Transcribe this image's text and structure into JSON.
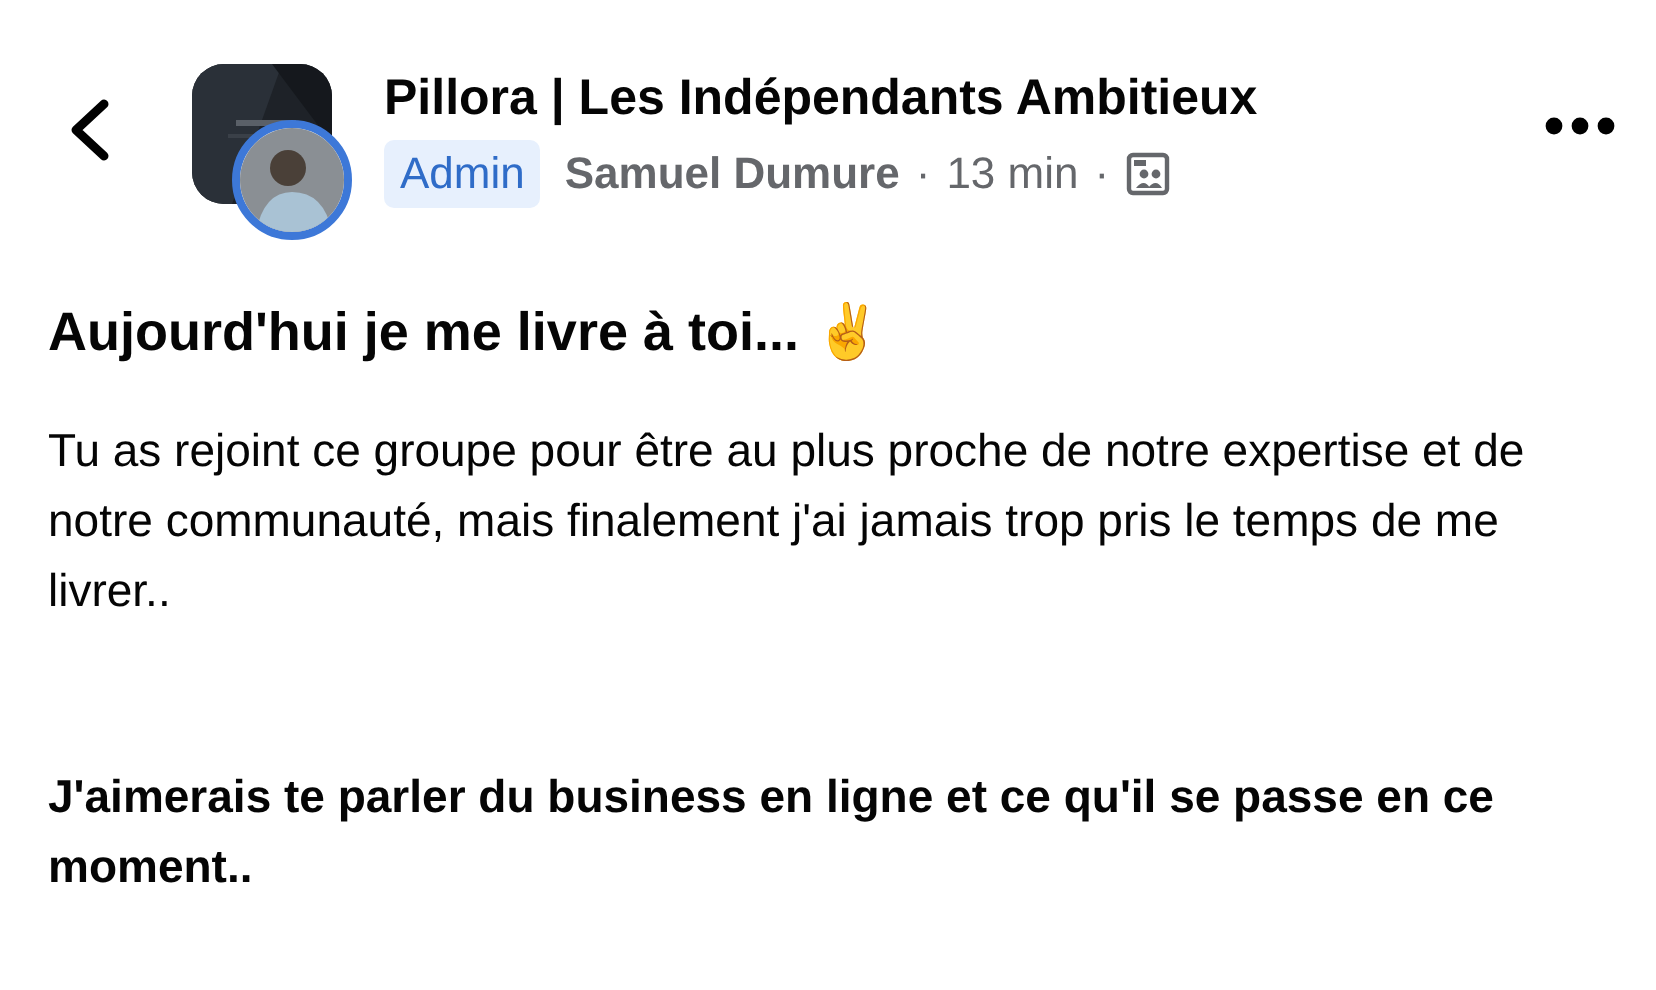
{
  "header": {
    "group_name": "Pillora | Les Indépendants Ambitieux",
    "role_badge": "Admin",
    "author": "Samuel Dumure",
    "separator_1": "·",
    "time": "13 min",
    "separator_2": "·"
  },
  "post": {
    "title": "Aujourd'hui je me livre à toi... ✌️",
    "paragraphs": [
      {
        "text": "Tu as rejoint ce groupe pour être au plus proche de notre expertise et de notre communauté, mais finalement j'ai jamais trop pris le temps de me livrer..",
        "bold": false
      },
      {
        "text": "J'aimerais te parler du business en ligne et ce qu'il se passe en ce moment..",
        "bold": true
      }
    ]
  }
}
